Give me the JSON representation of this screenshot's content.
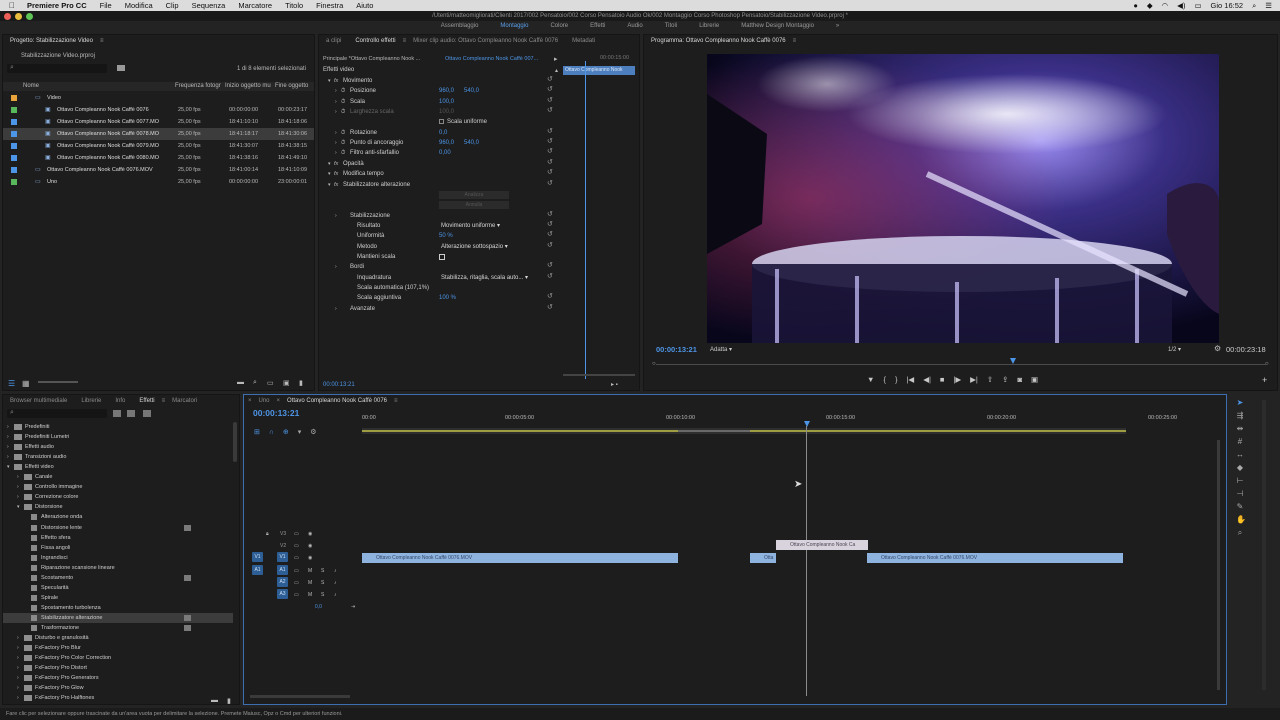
{
  "menubar": {
    "app": "Premiere Pro CC",
    "items": [
      "File",
      "Modifica",
      "Clip",
      "Sequenza",
      "Marcatore",
      "Titolo",
      "Finestra",
      "Aiuto"
    ],
    "clock": "Gio 16:52"
  },
  "titlebar": {
    "path": "/Utenti/matteomigliorati/Clienti 2017/002 Pensatoio/002 Corso Pensatoio Audio Ok/002 Montaggio Corso Photoshop Pensatoio/Stabilizzazione Video.prproj *"
  },
  "workspaces": [
    {
      "label": "Assemblaggio",
      "active": false
    },
    {
      "label": "Montaggio",
      "active": true
    },
    {
      "label": "Colore",
      "active": false
    },
    {
      "label": "Effetti",
      "active": false
    },
    {
      "label": "Audio",
      "active": false
    },
    {
      "label": "Titoli",
      "active": false
    },
    {
      "label": "Librerie",
      "active": false
    },
    {
      "label": "Matthew Design Montaggio",
      "active": false
    }
  ],
  "project": {
    "tab": "Progetto: Stabilizzazione Video",
    "filename": "Stabilizzazione Video.prproj",
    "selection_count": "1 di 8 elementi selezionati",
    "columns": {
      "name": "Nome",
      "fps": "Frequenza fotogr",
      "start": "Inizio oggetto mu",
      "end": "Fine oggetto"
    },
    "items": [
      {
        "name": "Video",
        "fps": "",
        "start": "",
        "end": "",
        "color": "#e9a33b",
        "indent": 1,
        "selected": false
      },
      {
        "name": "Ottavo Compleanno Nook Caffè 0076",
        "fps": "25,00 fps",
        "start": "00:00:00:00",
        "end": "00:00:23:17",
        "color": "#58b85b",
        "indent": 2,
        "selected": false
      },
      {
        "name": "Ottavo Compleanno Nook Caffè 0077.MO",
        "fps": "25,00 fps",
        "start": "18:41:10:10",
        "end": "18:41:18:06",
        "color": "#4d95e6",
        "indent": 2,
        "selected": false
      },
      {
        "name": "Ottavo Compleanno Nook Caffè 0078.MO",
        "fps": "25,00 fps",
        "start": "18:41:18:17",
        "end": "18:41:30:06",
        "color": "#4d95e6",
        "indent": 2,
        "selected": true
      },
      {
        "name": "Ottavo Compleanno Nook Caffè 0079.MO",
        "fps": "25,00 fps",
        "start": "18:41:30:07",
        "end": "18:41:38:15",
        "color": "#4d95e6",
        "indent": 2,
        "selected": false
      },
      {
        "name": "Ottavo Compleanno Nook Caffè 0080.MO",
        "fps": "25,00 fps",
        "start": "18:41:38:16",
        "end": "18:41:49:10",
        "color": "#4d95e6",
        "indent": 2,
        "selected": false
      },
      {
        "name": "Ottavo Compleanno Nook Caffè 0076.MOV",
        "fps": "25,00 fps",
        "start": "18:41:00:14",
        "end": "18:41:10:09",
        "color": "#4d95e6",
        "indent": 1,
        "selected": false
      },
      {
        "name": "Uno",
        "fps": "25,00 fps",
        "start": "00:00:00:00",
        "end": "23:00:00:01",
        "color": "#58b85b",
        "indent": 1,
        "selected": false
      }
    ]
  },
  "source": {
    "tabs": [
      {
        "label": "a clipi",
        "active": false
      },
      {
        "label": "Controllo effetti",
        "active": true
      },
      {
        "label": "Mixer clip audio: Ottavo Compleanno Nook Caffè 0076",
        "active": false
      },
      {
        "label": "Metadati",
        "active": false
      }
    ],
    "master": "Principale *Ottavo Compleanno Nook ...",
    "clip": "Ottavo Compleanno Nook Caffè 007...",
    "timecode_mini": "00:00:15:00",
    "mini_clip": "Ottavo Compleanno Nook",
    "current_tc": "00:00:13:21",
    "section_video": "Effetti video",
    "rows": [
      {
        "label": "Movimento",
        "value": "",
        "indent": 1
      },
      {
        "label": "Posizione",
        "value": "960,0",
        "value2": "540,0",
        "indent": 2
      },
      {
        "label": "Scala",
        "value": "100,0",
        "indent": 2
      },
      {
        "label": "Larghezza scala",
        "value": "100,0",
        "indent": 2,
        "dim": true
      },
      {
        "label": "",
        "value": "Scala uniforme",
        "indent": 3,
        "check": true
      },
      {
        "label": "Rotazione",
        "value": "0,0",
        "indent": 2
      },
      {
        "label": "Punto di ancoraggio",
        "value": "960,0",
        "value2": "540,0",
        "indent": 2
      },
      {
        "label": "Filtro anti-sfarfallio",
        "value": "0,00",
        "indent": 2
      },
      {
        "label": "Opacità",
        "value": "",
        "indent": 1
      },
      {
        "label": "Modifica tempo",
        "value": "",
        "indent": 1
      },
      {
        "label": "Stabilizzatore alterazione",
        "value": "",
        "indent": 1
      },
      {
        "label": "",
        "value": "Analizza",
        "indent": 4,
        "button": true
      },
      {
        "label": "",
        "value": "Annulla",
        "indent": 4,
        "button": true
      },
      {
        "label": "Stabilizzazione",
        "value": "",
        "indent": 2
      },
      {
        "label": "Risultato",
        "value": "Movimento uniforme",
        "indent": 3,
        "dropdown": true
      },
      {
        "label": "Uniformità",
        "value": "50 %",
        "indent": 3
      },
      {
        "label": "Metodo",
        "value": "Alterazione sottospazio",
        "indent": 3,
        "dropdown": true
      },
      {
        "label": "Mantieni scala",
        "value": "",
        "indent": 3,
        "check": true
      },
      {
        "label": "Bordi",
        "value": "",
        "indent": 2
      },
      {
        "label": "Inquadratura",
        "value": "Stabilizza, ritaglia, scala auto...",
        "indent": 3,
        "dropdown": true
      },
      {
        "label": "Scala automatica (107,1%)",
        "value": "",
        "indent": 3
      },
      {
        "label": "Scala aggiuntiva",
        "value": "100 %",
        "indent": 3
      },
      {
        "label": "Avanzate",
        "value": "",
        "indent": 2
      }
    ]
  },
  "program": {
    "title": "Programma: Ottavo Compleanno Nook Caffè 0076",
    "current_tc": "00:00:13:21",
    "fit": "Adatta",
    "resolution": "1/2",
    "duration": "00:00:23:18"
  },
  "effects_panel": {
    "tabs": [
      {
        "label": "Browser multimediale",
        "active": false
      },
      {
        "label": "Librerie",
        "active": false
      },
      {
        "label": "Info",
        "active": false
      },
      {
        "label": "Effetti",
        "active": true
      },
      {
        "label": "Marcatori",
        "active": false
      }
    ],
    "tree": [
      {
        "label": "Predefiniti",
        "level": 0,
        "type": "folder",
        "open": false
      },
      {
        "label": "Predefiniti Lumetri",
        "level": 0,
        "type": "folder",
        "open": false
      },
      {
        "label": "Effetti audio",
        "level": 0,
        "type": "folder",
        "open": false
      },
      {
        "label": "Transizioni audio",
        "level": 0,
        "type": "folder",
        "open": false
      },
      {
        "label": "Effetti video",
        "level": 0,
        "type": "folder",
        "open": true
      },
      {
        "label": "Canale",
        "level": 1,
        "type": "folder",
        "open": false
      },
      {
        "label": "Controllo immagine",
        "level": 1,
        "type": "folder",
        "open": false
      },
      {
        "label": "Correzione colore",
        "level": 1,
        "type": "folder",
        "open": false
      },
      {
        "label": "Distorsione",
        "level": 1,
        "type": "folder",
        "open": true
      },
      {
        "label": "Alterazione onda",
        "level": 2,
        "type": "effect"
      },
      {
        "label": "Distorsione lente",
        "level": 2,
        "type": "effect",
        "badge": true
      },
      {
        "label": "Effetto sfera",
        "level": 2,
        "type": "effect"
      },
      {
        "label": "Fissa angoli",
        "level": 2,
        "type": "effect"
      },
      {
        "label": "Ingrandisci",
        "level": 2,
        "type": "effect"
      },
      {
        "label": "Riparazione scansione lineare",
        "level": 2,
        "type": "effect"
      },
      {
        "label": "Scostamento",
        "level": 2,
        "type": "effect",
        "badge": true
      },
      {
        "label": "Specularità",
        "level": 2,
        "type": "effect"
      },
      {
        "label": "Spirale",
        "level": 2,
        "type": "effect"
      },
      {
        "label": "Spostamento turbolenza",
        "level": 2,
        "type": "effect"
      },
      {
        "label": "Stabilizzatore alterazione",
        "level": 2,
        "type": "effect",
        "badge": true,
        "selected": true
      },
      {
        "label": "Trasformazione",
        "level": 2,
        "type": "effect",
        "badge": true
      },
      {
        "label": "Disturbo e granulosità",
        "level": 1,
        "type": "folder",
        "open": false
      },
      {
        "label": "FxFactory Pro Blur",
        "level": 1,
        "type": "folder",
        "open": false
      },
      {
        "label": "FxFactory Pro Color Correction",
        "level": 1,
        "type": "folder",
        "open": false
      },
      {
        "label": "FxFactory Pro Distort",
        "level": 1,
        "type": "folder",
        "open": false
      },
      {
        "label": "FxFactory Pro Generators",
        "level": 1,
        "type": "folder",
        "open": false
      },
      {
        "label": "FxFactory Pro Glow",
        "level": 1,
        "type": "folder",
        "open": false
      },
      {
        "label": "FxFactory Pro Halftones",
        "level": 1,
        "type": "folder",
        "open": false
      }
    ]
  },
  "timeline": {
    "tabs": [
      {
        "label": "Uno",
        "active": false
      },
      {
        "label": "Ottavo Compleanno Nook Caffè 0076",
        "active": true
      }
    ],
    "current_tc": "00:00:13:21",
    "ruler": [
      "00:00",
      "00:00:05:00",
      "00:00:10:00",
      "00:00:15:00",
      "00:00:20:00",
      "00:00:25:00"
    ],
    "tracks_video": [
      "V3",
      "V2",
      "V1"
    ],
    "tracks_audio": [
      "A1",
      "A2",
      "A3"
    ],
    "source_patch_v": "V1",
    "source_patch_a": "A1",
    "master_level": "0,0",
    "clips": {
      "v1_a": "Ottavo Compleanno Nook Caffè 0076.MOV",
      "v1_b": "Otta",
      "v1_c": "Ottavo Compleanno Nook Caffè 0076.MOV",
      "v2_a": "Ottavo Compleanno Nook Ca"
    }
  },
  "status": "Fare clic per selezionare oppure trascinate da un'area vuota per delimitare la selezione. Premete Maiusc, Opz o Cmd per ulteriori funzioni."
}
